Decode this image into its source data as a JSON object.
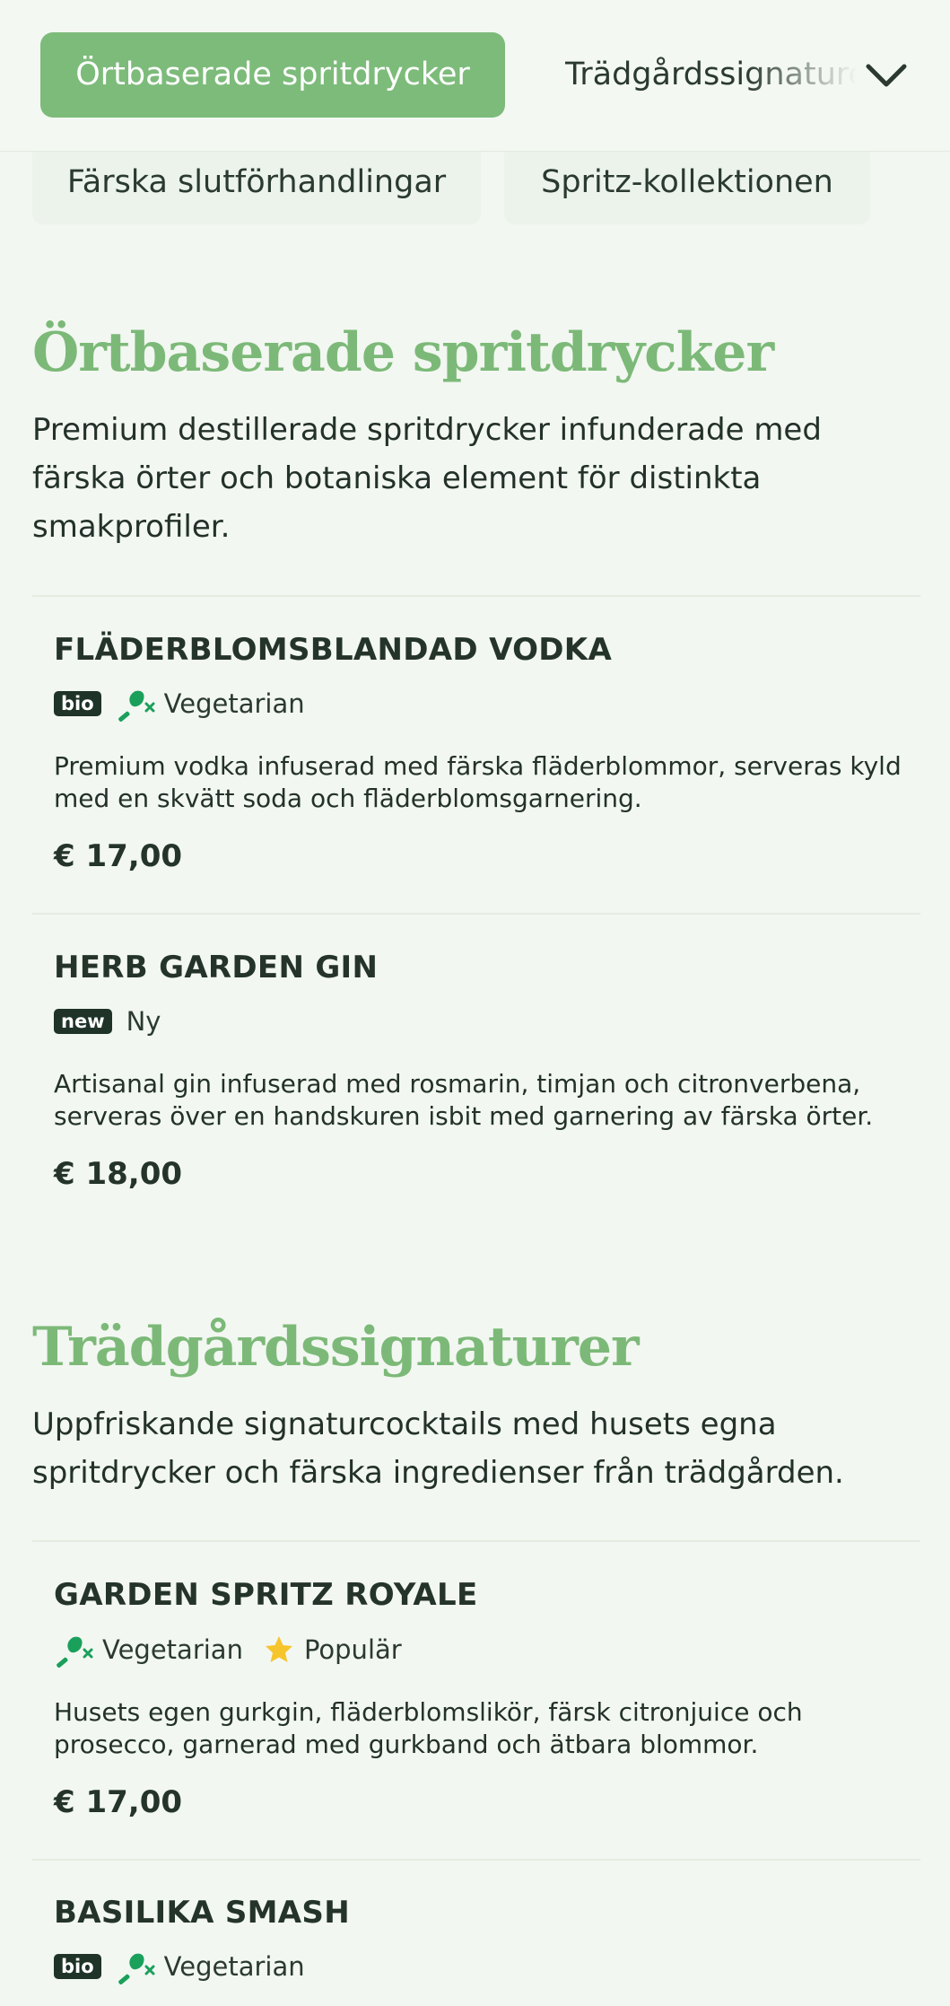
{
  "nav": {
    "active_label": "Örtbaserade spritdrycker",
    "next_label": "Trädgårdssignaturer",
    "secondary": [
      "Färska slutförhandlingar",
      "Spritz-kollektionen"
    ],
    "chevron_icon": "chevron-down-icon"
  },
  "colors": {
    "accent": "#7dbb7a",
    "badge": "#1f3328",
    "vegetarian_icon": "#1aa05b",
    "star": "#f6c52b"
  },
  "sections": [
    {
      "title": "Örtbaserade spritdrycker",
      "description": "Premium destillerade spritdrycker infunderade med färska örter och botaniska element för distinkta smakprofiler.",
      "items": [
        {
          "name": "FLÄDERBLOMSBLANDAD VODKA",
          "badge": "bio",
          "tag": "Vegetarian",
          "description": "Premium vodka infuserad med färska fläderblommor, serveras kyld med en skvätt soda och fläderblomsgarnering.",
          "price": "€ 17,00"
        },
        {
          "name": "HERB GARDEN GIN",
          "badge": "new",
          "tag": "Ny",
          "description": "Artisanal gin infuserad med rosmarin, timjan och citronverbena, serveras över en handskuren isbit med garnering av färska örter.",
          "price": "€ 18,00"
        }
      ]
    },
    {
      "title": "Trädgårdssignaturer",
      "description": "Uppfriskande signaturcocktails med husets egna spritdrycker och färska ingredienser från trädgården.",
      "items": [
        {
          "name": "GARDEN SPRITZ ROYALE",
          "tag": "Vegetarian",
          "tag2": "Populär",
          "description": "Husets egen gurkgin, fläderblomslikör, färsk citronjuice och prosecco, garnerad med gurkband och ätbara blommor.",
          "price": "€ 17,00"
        },
        {
          "name": "BASILIKA SMASH",
          "badge": "bio",
          "tag": "Vegetarian"
        }
      ]
    }
  ]
}
